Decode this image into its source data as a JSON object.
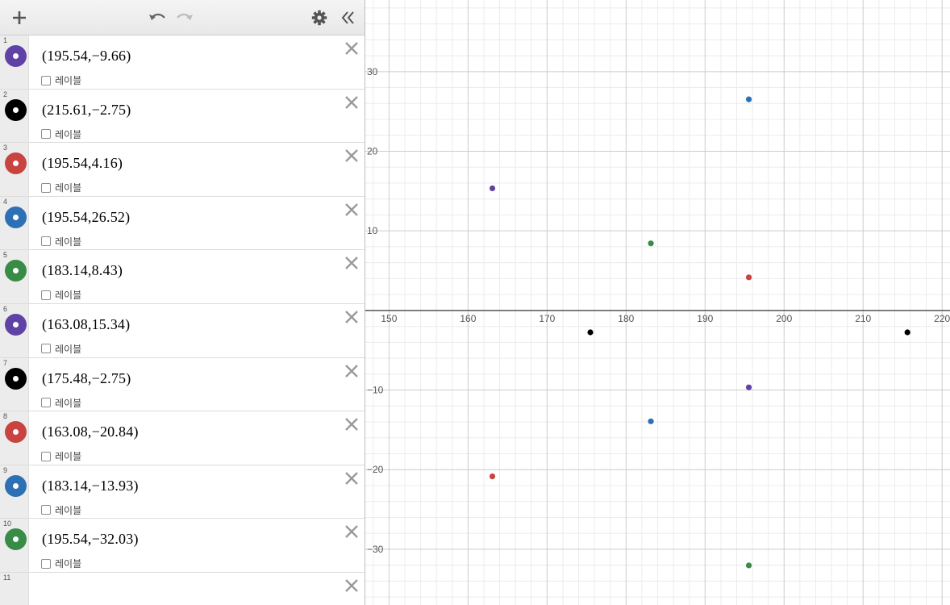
{
  "toolbar": {
    "add_icon": "plus-icon",
    "undo_icon": "undo-icon",
    "redo_icon": "redo-icon",
    "settings_icon": "gear-icon",
    "collapse_icon": "double-chevron-left-icon"
  },
  "colors": {
    "purple": "#6042a6",
    "black": "#000000",
    "red": "#c74440",
    "blue": "#2d70b3",
    "green": "#388c46"
  },
  "expressions": [
    {
      "index": "1",
      "text": "(195.54,−9.66)",
      "label": "레이블",
      "color": "#6042a6",
      "x": 195.54,
      "y": -9.66
    },
    {
      "index": "2",
      "text": "(215.61,−2.75)",
      "label": "레이블",
      "color": "#000000",
      "x": 215.61,
      "y": -2.75
    },
    {
      "index": "3",
      "text": "(195.54,4.16)",
      "label": "레이블",
      "color": "#c74440",
      "x": 195.54,
      "y": 4.16
    },
    {
      "index": "4",
      "text": "(195.54,26.52)",
      "label": "레이블",
      "color": "#2d70b3",
      "x": 195.54,
      "y": 26.52
    },
    {
      "index": "5",
      "text": "(183.14,8.43)",
      "label": "레이블",
      "color": "#388c46",
      "x": 183.14,
      "y": 8.43
    },
    {
      "index": "6",
      "text": "(163.08,15.34)",
      "label": "레이블",
      "color": "#6042a6",
      "x": 163.08,
      "y": 15.34
    },
    {
      "index": "7",
      "text": "(175.48,−2.75)",
      "label": "레이블",
      "color": "#000000",
      "x": 175.48,
      "y": -2.75
    },
    {
      "index": "8",
      "text": "(163.08,−20.84)",
      "label": "레이블",
      "color": "#c74440",
      "x": 163.08,
      "y": -20.84
    },
    {
      "index": "9",
      "text": "(183.14,−13.93)",
      "label": "레이블",
      "color": "#2d70b3",
      "x": 183.14,
      "y": -13.93
    },
    {
      "index": "10",
      "text": "(195.54,−32.03)",
      "label": "레이블",
      "color": "#388c46",
      "x": 195.54,
      "y": -32.03
    }
  ],
  "empty_row": {
    "index": "11"
  },
  "chart_data": {
    "type": "scatter",
    "xlim": [
      147,
      221
    ],
    "ylim": [
      -37,
      39
    ],
    "grid": true,
    "x_ticks": [
      "150",
      "160",
      "170",
      "180",
      "190",
      "200",
      "210",
      "220"
    ],
    "y_ticks": [
      "30",
      "20",
      "10",
      "−10",
      "−20",
      "−30"
    ]
  }
}
